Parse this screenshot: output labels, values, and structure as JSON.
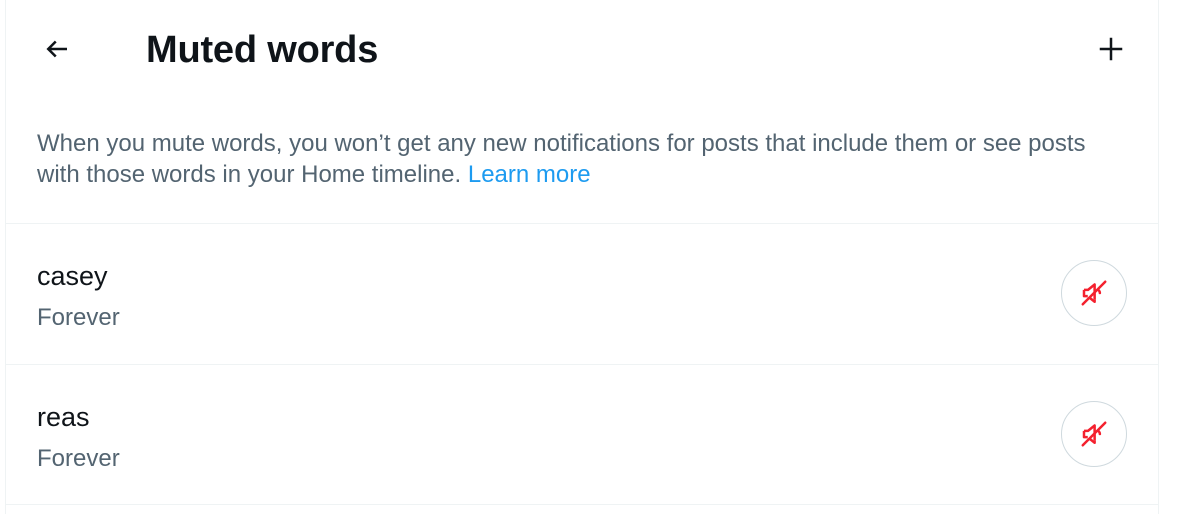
{
  "header": {
    "title": "Muted words",
    "back_icon": "arrow-left-icon",
    "add_icon": "plus-icon"
  },
  "description": {
    "text": "When you mute words, you won’t get any new notifications for posts that include them or see posts with those words in your Home timeline.",
    "link_label": "Learn more"
  },
  "muted_words": [
    {
      "word": "casey",
      "duration": "Forever",
      "action_icon": "speaker-muted-icon"
    },
    {
      "word": "reas",
      "duration": "Forever",
      "action_icon": "speaker-muted-icon"
    }
  ],
  "colors": {
    "text_primary": "#0f1419",
    "text_secondary": "#536471",
    "link": "#1d9bf0",
    "unmute_icon": "#f4212e",
    "divider": "#eff3f4"
  }
}
